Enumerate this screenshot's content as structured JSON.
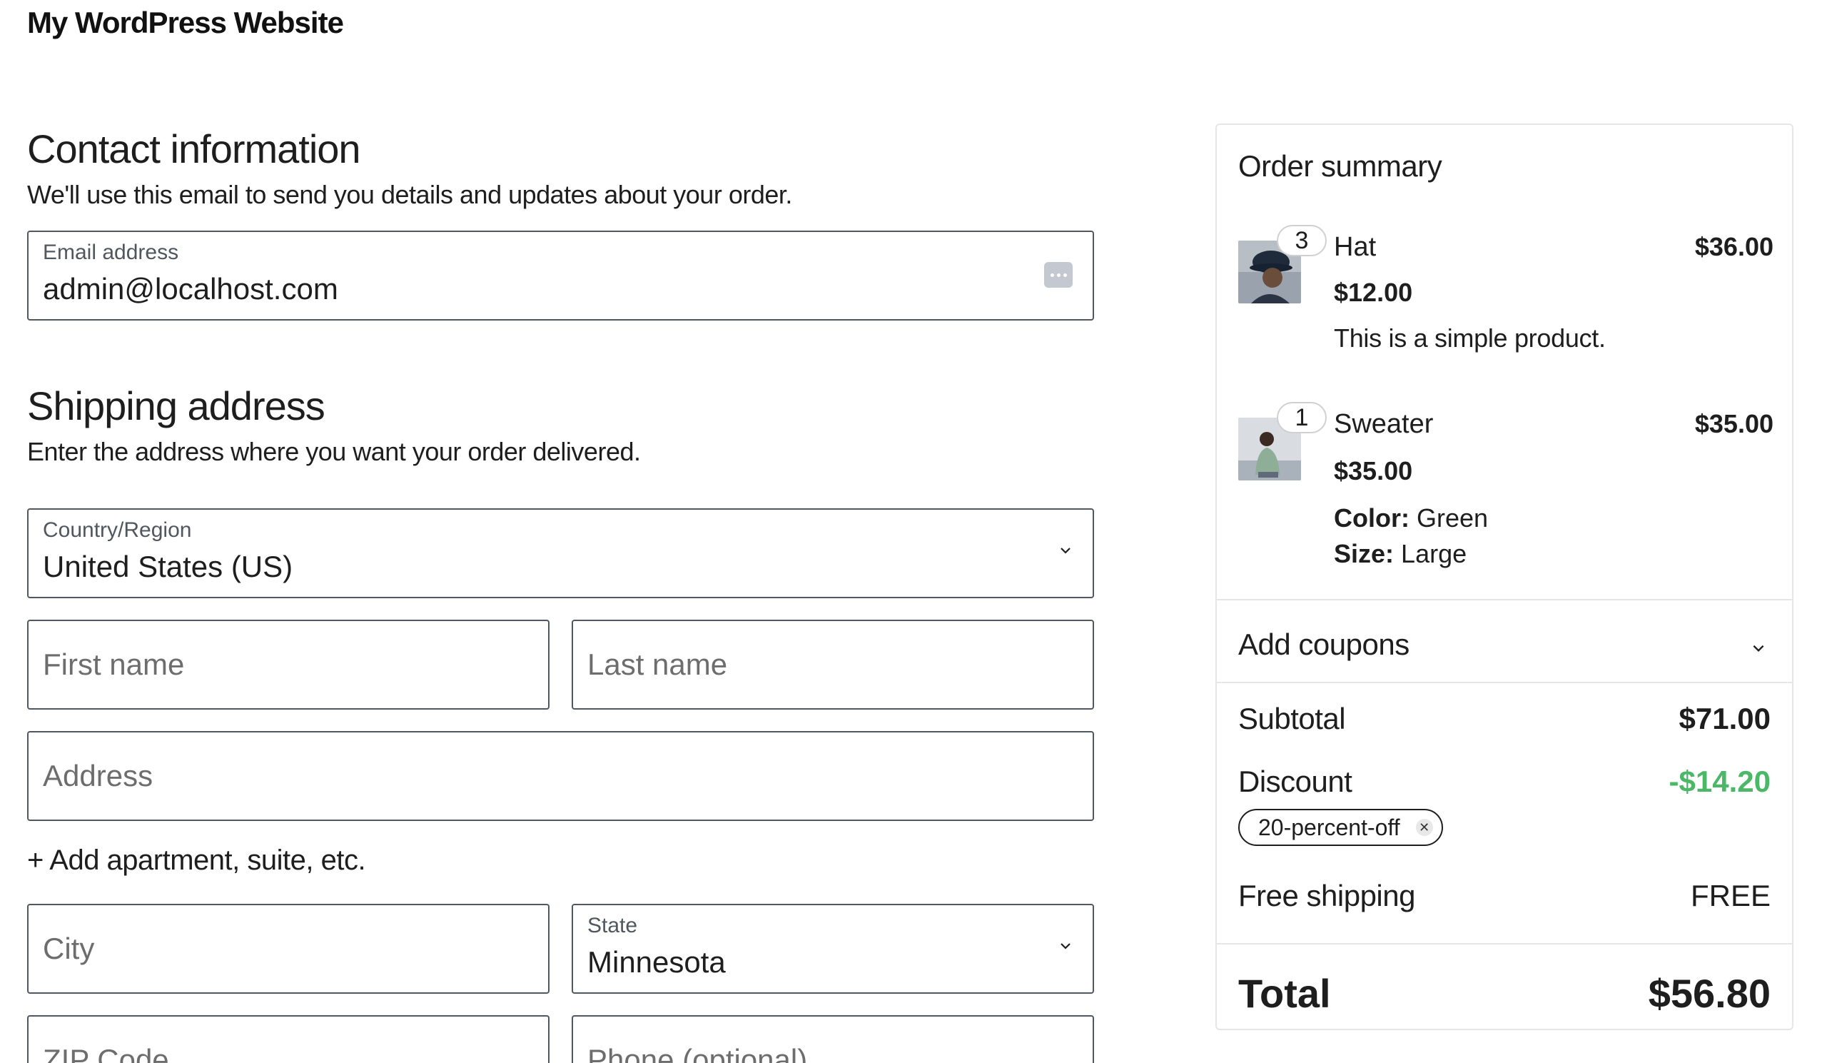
{
  "site": {
    "title": "My WordPress Website"
  },
  "contact": {
    "heading": "Contact information",
    "description": "We'll use this email to send you details and updates about your order.",
    "email_label": "Email address",
    "email_value": "admin@localhost.com"
  },
  "shipping": {
    "heading": "Shipping address",
    "description": "Enter the address where you want your order delivered.",
    "country_label": "Country/Region",
    "country_value": "United States (US)",
    "first_name_placeholder": "First name",
    "last_name_placeholder": "Last name",
    "address_placeholder": "Address",
    "add_apartment": "+ Add apartment, suite, etc.",
    "city_placeholder": "City",
    "state_label": "State",
    "state_value": "Minnesota",
    "zip_placeholder": "ZIP Code",
    "phone_placeholder": "Phone (optional)"
  },
  "summary": {
    "title": "Order summary",
    "items": [
      {
        "quantity": "3",
        "name": "Hat",
        "line_total": "$36.00",
        "unit_price": "$12.00",
        "description": "This is a simple product."
      },
      {
        "quantity": "1",
        "name": "Sweater",
        "line_total": "$35.00",
        "unit_price": "$35.00",
        "attributes": [
          {
            "key": "Color:",
            "value": "Green"
          },
          {
            "key": "Size:",
            "value": "Large"
          }
        ]
      }
    ],
    "add_coupons": "Add coupons",
    "subtotal_label": "Subtotal",
    "subtotal_value": "$71.00",
    "discount_label": "Discount",
    "discount_value": "-$14.20",
    "coupon_code": "20-percent-off",
    "shipping_label": "Free shipping",
    "shipping_value": "FREE",
    "total_label": "Total",
    "total_value": "$56.80"
  },
  "colors": {
    "border": "#50575e",
    "discount": "#4ab866",
    "panel_border": "#e6e6e6"
  }
}
